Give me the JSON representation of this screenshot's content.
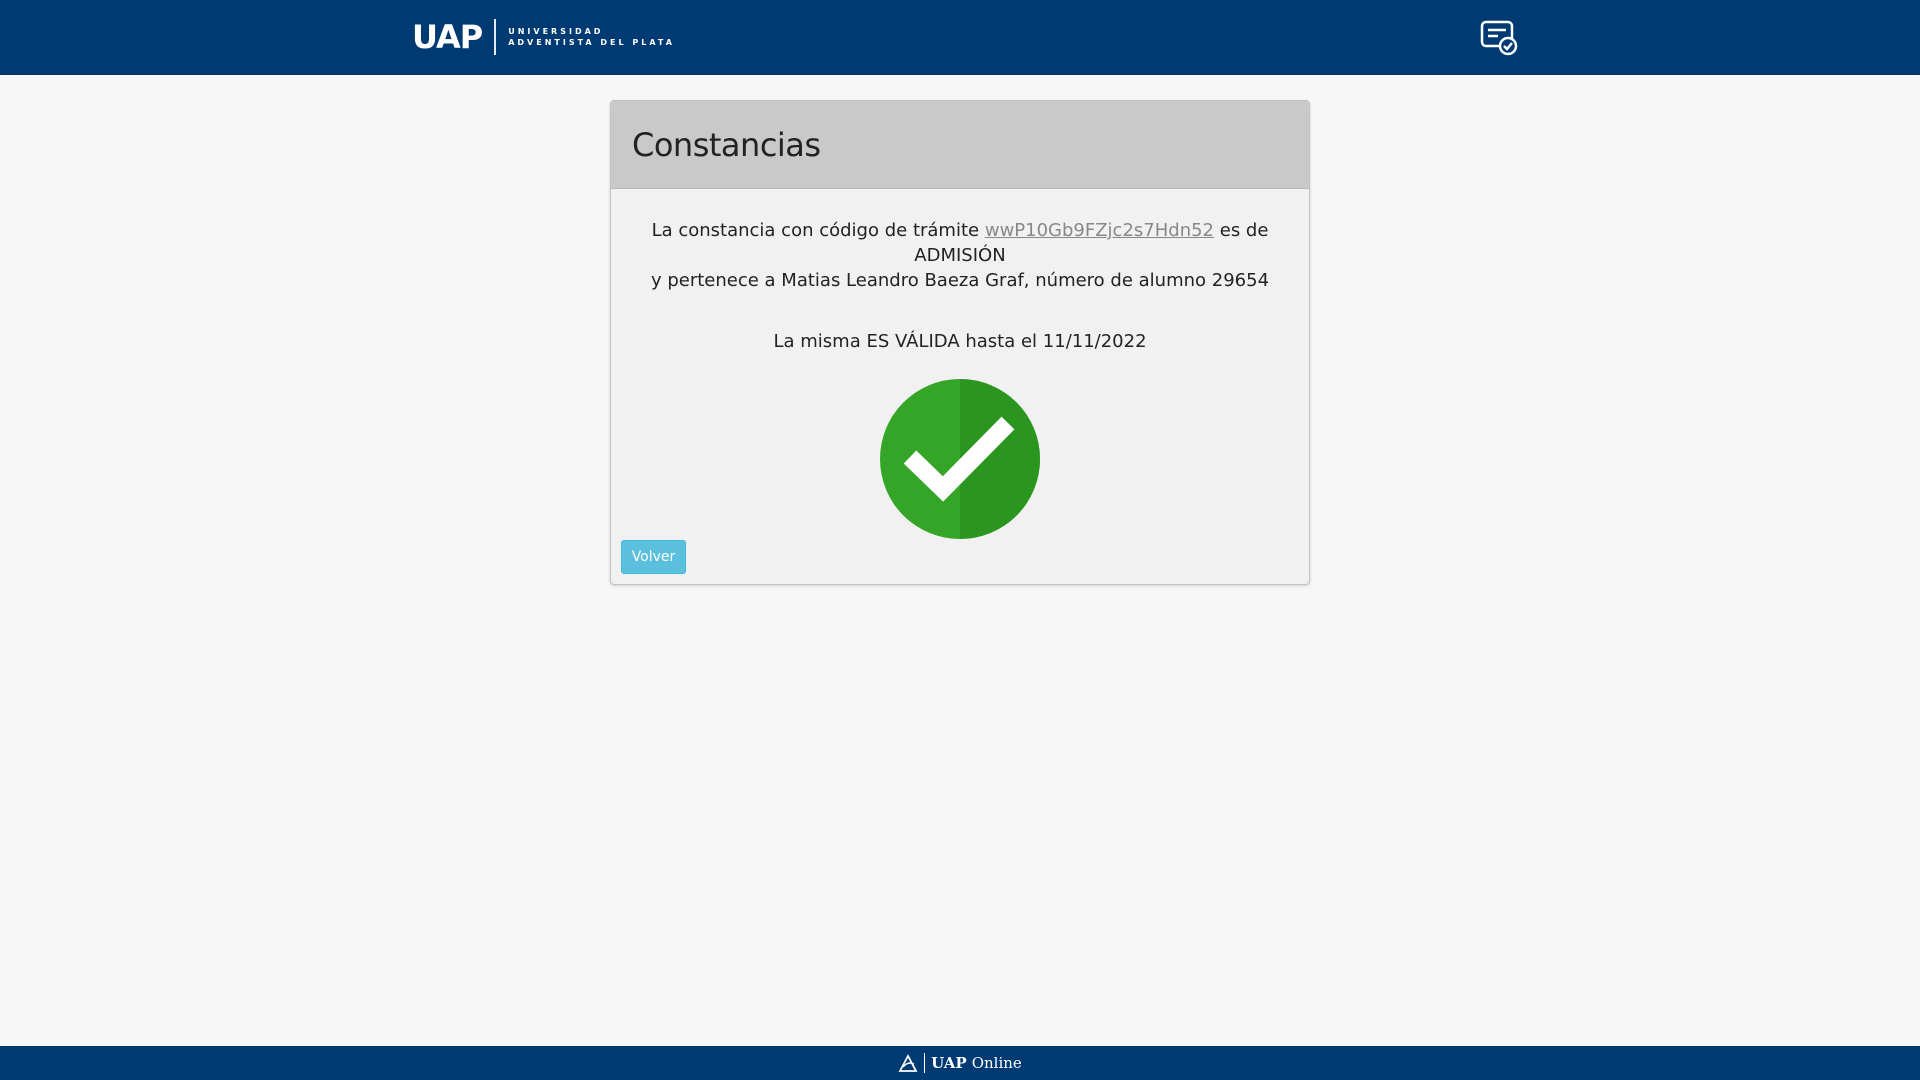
{
  "header": {
    "logo_mark": "UAP",
    "logo_line1": "UNIVERSIDAD",
    "logo_line2": "ADVENTISTA DEL PLATA",
    "certificate_icon": "certificate-check-icon"
  },
  "card": {
    "title": "Constancias",
    "message_prefix": "La constancia con código de trámite",
    "code": "wwP10Gb9FZjc2s7Hdn52",
    "message_middle": "es de ADMISIÓN",
    "message_line2": "y pertenece a Matias Leandro Baeza Graf, número de alumno 29654",
    "validity": "La misma ES VÁLIDA hasta el 11/11/2022",
    "status_icon": "check-circle-icon",
    "back_button": "Volver"
  },
  "footer": {
    "brand": "UAP",
    "suffix": "Online",
    "icon": "church-logo-icon"
  },
  "colors": {
    "header_bg": "#003a72",
    "card_header_bg": "#c9c9c9",
    "success_green": "#35a528",
    "button_bg": "#5bc0de"
  }
}
